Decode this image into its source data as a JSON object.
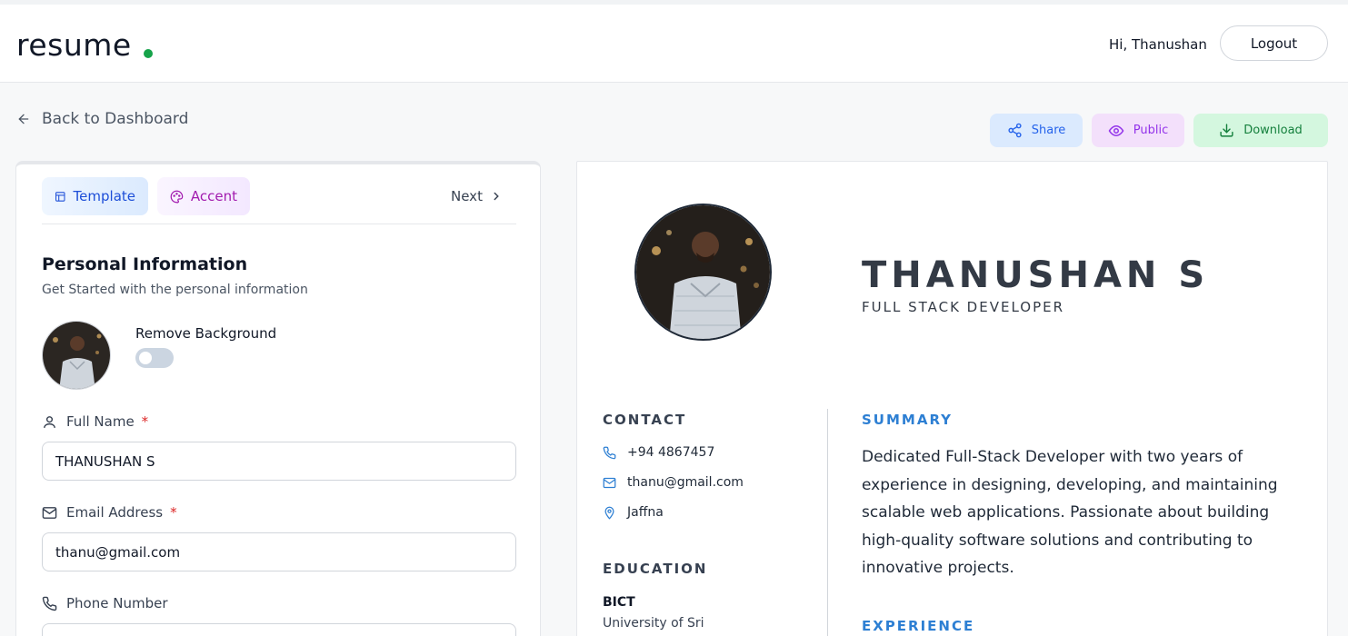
{
  "header": {
    "logo": "resume",
    "greeting": "Hi, Thanushan",
    "logout_label": "Logout"
  },
  "nav": {
    "back_label": "Back to Dashboard"
  },
  "actions": {
    "share_label": "Share",
    "public_label": "Public",
    "download_label": "Download"
  },
  "editor": {
    "tabs": [
      {
        "label": "Template"
      },
      {
        "label": "Accent"
      }
    ],
    "next_label": "Next",
    "section_title": "Personal Information",
    "section_subtitle": "Get Started with the personal information",
    "remove_background_label": "Remove Background",
    "remove_background_enabled": false,
    "fields": {
      "full_name": {
        "label": "Full Name",
        "required_mark": "*",
        "value": "THANUSHAN S"
      },
      "email": {
        "label": "Email Address",
        "required_mark": "*",
        "value": "thanu@gmail.com"
      },
      "phone": {
        "label": "Phone Number"
      }
    }
  },
  "resume": {
    "name": "THANUSHAN S",
    "role": "FULL STACK DEVELOPER",
    "contact_heading": "CONTACT",
    "contact": {
      "phone": "+94 4867457",
      "email": "thanu@gmail.com",
      "location": "Jaffna"
    },
    "education_heading": "EDUCATION",
    "education": {
      "degree": "BICT",
      "institution": "University of Sri"
    },
    "summary_heading": "SUMMARY",
    "summary": "Dedicated Full-Stack Developer with two years of experience in designing, developing, and maintaining scalable web applications. Passionate about building high-quality software solutions and contributing to innovative projects.",
    "experience_heading": "EXPERIENCE"
  },
  "colors": {
    "brand_dot": "#16a34a",
    "accent_blue": "#2d7fd3",
    "share_bg": "#dbeafe",
    "public_bg": "#f3e0fb",
    "download_bg": "#d4f7df"
  }
}
